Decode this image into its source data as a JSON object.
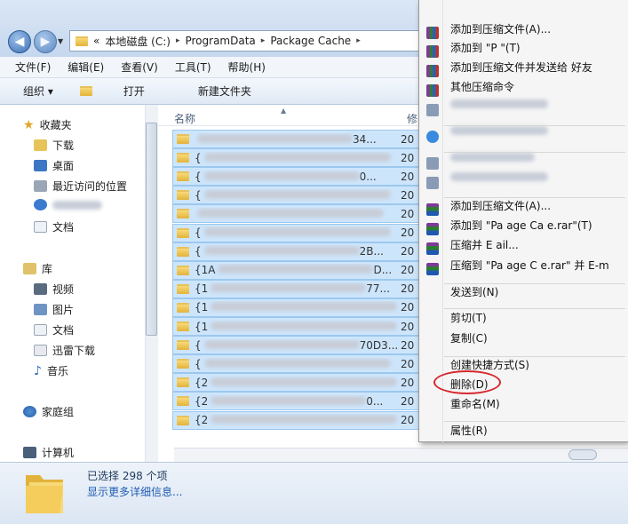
{
  "window": {
    "nav": {
      "back_icon": "back-arrow-icon",
      "forward_icon": "forward-arrow-icon"
    },
    "breadcrumb": {
      "overflow": "«",
      "items": [
        "本地磁盘 (C:)",
        "ProgramData",
        "Package Cache"
      ],
      "arrow": "▸"
    }
  },
  "menubar": {
    "items": [
      "文件(F)",
      "编辑(E)",
      "查看(V)",
      "工具(T)",
      "帮助(H)"
    ]
  },
  "toolbar": {
    "organize": "组织 ▾",
    "open": "打开",
    "new_folder": "新建文件夹"
  },
  "sidebar": {
    "favorites": {
      "label": "收藏夹",
      "items": [
        "下载",
        "桌面",
        "最近访问的位置",
        "",
        "文档"
      ]
    },
    "libraries": {
      "label": "库",
      "items": [
        "视频",
        "图片",
        "文档",
        "迅雷下载",
        "音乐"
      ]
    },
    "homegroup": "家庭组",
    "computer": "计算机"
  },
  "filelist": {
    "columns": {
      "name": "名称",
      "modified": "修"
    },
    "rows": [
      {
        "name": "",
        "date": "20",
        "tail": "34..."
      },
      {
        "name": "{",
        "date": "20",
        "tail": ""
      },
      {
        "name": "{",
        "date": "20",
        "tail": "0..."
      },
      {
        "name": "{",
        "date": "20",
        "tail": ""
      },
      {
        "name": "",
        "date": "20",
        "tail": ""
      },
      {
        "name": "{",
        "date": "20",
        "tail": ""
      },
      {
        "name": "{",
        "date": "20",
        "tail": "2B..."
      },
      {
        "name": "{1A",
        "date": "20",
        "tail": "D..."
      },
      {
        "name": "{1",
        "date": "20",
        "tail": "77..."
      },
      {
        "name": "{1",
        "date": "20",
        "tail": ""
      },
      {
        "name": "{1",
        "date": "20",
        "tail": ""
      },
      {
        "name": "{",
        "date": "20",
        "tail": "70D3..."
      },
      {
        "name": "{",
        "date": "20",
        "tail": ""
      },
      {
        "name": "{2",
        "date": "20",
        "tail": ""
      },
      {
        "name": "{2",
        "date": "20",
        "tail": "0..."
      },
      {
        "name": "{2",
        "date": "20",
        "tail": ""
      }
    ]
  },
  "status": {
    "selected": "已选择 298 个项",
    "more_details": "显示更多详细信息..."
  },
  "context_menu": {
    "items": [
      {
        "label": "添加到压缩文件(A)...",
        "icon": "winrar-icon"
      },
      {
        "label": "添加到 \"P          \"(T)",
        "icon": "winrar-icon"
      },
      {
        "label": "添加到压缩文件并发送给       好友",
        "icon": "winrar-icon"
      },
      {
        "label": "其他压缩命令",
        "icon": "winrar-icon"
      },
      {
        "label": "",
        "icon": "app-icon"
      },
      {
        "label": "",
        "icon": "cloud-icon"
      },
      {
        "label": "",
        "icon": "app-icon"
      },
      {
        "label": "",
        "icon": "app-icon"
      },
      {
        "label": "添加到压缩文件(A)...",
        "icon": "rar-books-icon"
      },
      {
        "label": "添加到 \"Pa   age Ca  e.rar\"(T)",
        "icon": "rar-books-icon"
      },
      {
        "label": "压缩并 E   ail...",
        "icon": "rar-books-icon"
      },
      {
        "label": "压缩到 \"Pa   age C   e.rar\" 并 E-m",
        "icon": "rar-books-icon"
      },
      {
        "label": "发送到(N)"
      },
      {
        "label": "剪切(T)"
      },
      {
        "label": "复制(C)"
      },
      {
        "label": "创建快捷方式(S)"
      },
      {
        "label": "删除(D)"
      },
      {
        "label": "重命名(M)"
      },
      {
        "label": "属性(R)"
      }
    ]
  },
  "colors": {
    "selection": "#cde5fb",
    "highlight_circle": "#d6282e",
    "link": "#1e5cb3"
  }
}
